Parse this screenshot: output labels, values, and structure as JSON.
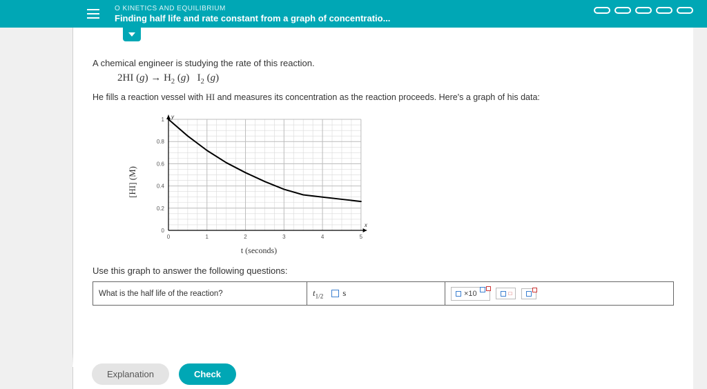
{
  "header": {
    "crumb": "O KINETICS AND EQUILIBRIUM",
    "title": "Finding half life and rate constant from a graph of concentratio..."
  },
  "prompt1": "A chemical engineer is studying the rate of this reaction.",
  "equation": "2HI (g) → H₂ (g) + I₂ (g)",
  "prompt2": "He fills a reaction vessel with HI and measures its concentration as the reaction proceeds. Here's a graph of his data:",
  "useline": "Use this graph to answer the following questions:",
  "question_row": {
    "q": "What is the half life of the reaction?",
    "answer_prefix": "t",
    "answer_sub": "1/2",
    "answer_unit": "s"
  },
  "buttons": {
    "explanation": "Explanation",
    "check": "Check"
  },
  "tools": {
    "sci": "×10"
  },
  "chart_data": {
    "type": "line",
    "title": "",
    "xlabel": "t (seconds)",
    "ylabel": "[HI] (M)",
    "xlim": [
      0,
      5.2
    ],
    "ylim": [
      0,
      1.05
    ],
    "xticks": [
      0,
      1,
      2,
      3,
      4,
      5
    ],
    "yticks_major": [
      0,
      0.2,
      0.4,
      0.6,
      0.8,
      1.0
    ],
    "series": [
      {
        "name": "[HI]",
        "x": [
          0,
          0.5,
          1,
          1.5,
          2,
          2.5,
          3,
          3.5,
          4,
          4.5,
          5
        ],
        "y": [
          1.0,
          0.85,
          0.72,
          0.61,
          0.52,
          0.44,
          0.37,
          0.32,
          0.3,
          0.28,
          0.26
        ]
      }
    ]
  }
}
